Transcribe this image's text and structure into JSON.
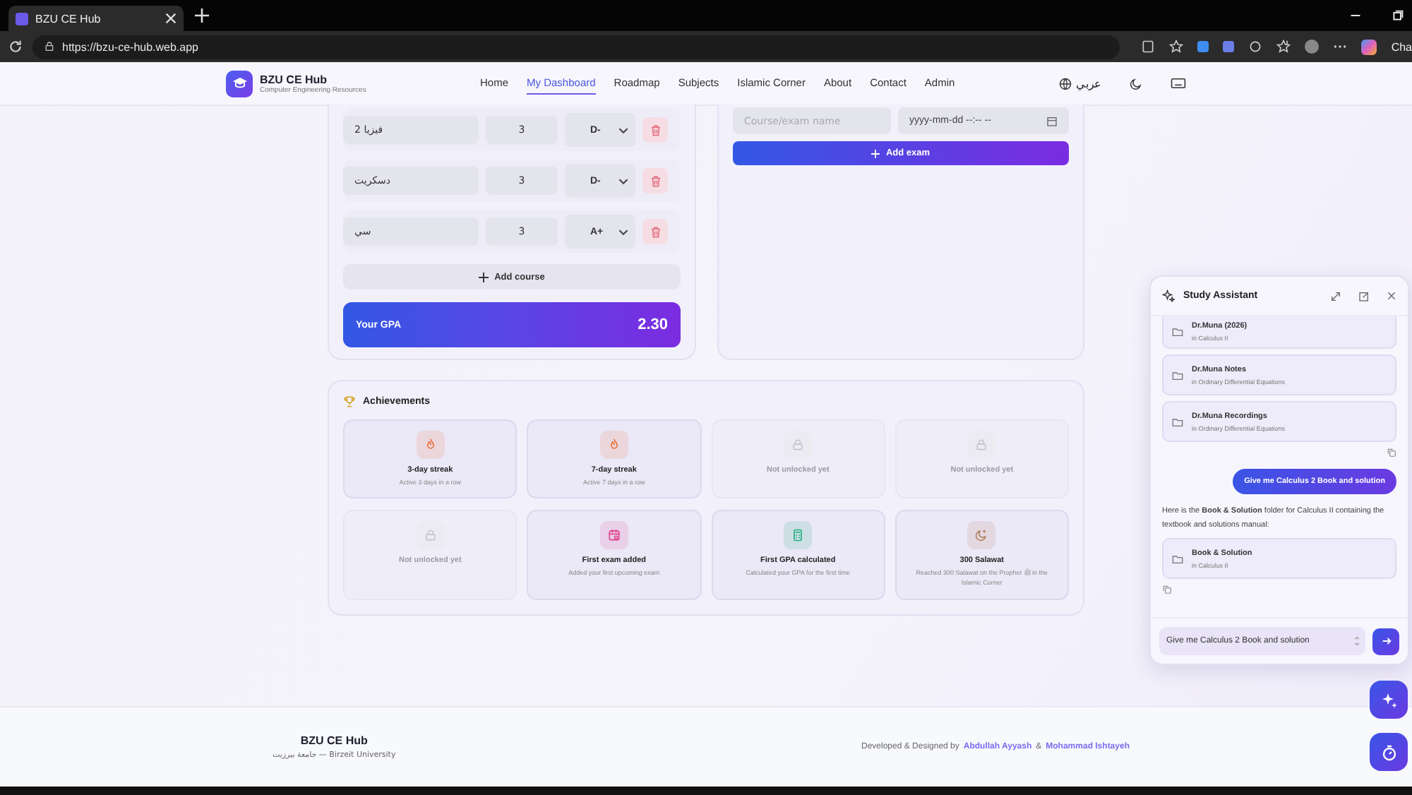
{
  "browser": {
    "tab_title": "BZU CE Hub",
    "url": "https://bzu-ce-hub.web.app",
    "profile_label": "Cha"
  },
  "nav": {
    "brand": "BZU CE Hub",
    "tagline": "Computer Engineering Resources",
    "language": "عربي",
    "links": [
      {
        "label": "Home",
        "selected": false
      },
      {
        "label": "My Dashboard",
        "selected": true
      },
      {
        "label": "Roadmap",
        "selected": false
      },
      {
        "label": "Subjects",
        "selected": false
      },
      {
        "label": "Islamic Corner",
        "selected": false
      },
      {
        "label": "About",
        "selected": false
      },
      {
        "label": "Contact",
        "selected": false
      },
      {
        "label": "Admin",
        "selected": false
      }
    ]
  },
  "gpa_calculator": {
    "courses": [
      {
        "name": "فيزيا 2",
        "credits": "3",
        "grade": "D-"
      },
      {
        "name": "دسكريت",
        "credits": "3",
        "grade": "D-"
      },
      {
        "name": "سي",
        "credits": "3",
        "grade": "A+"
      }
    ],
    "add_label": "Add course",
    "gpa_label": "Your GPA",
    "gpa_value": "2.30"
  },
  "exams": {
    "name_placeholder": "Course/exam name",
    "date_placeholder": "yyyy-mm-dd --:-- --",
    "add_label": "Add exam"
  },
  "achievements": {
    "title": "Achievements",
    "items": [
      {
        "unlocked": true,
        "kind": "streak",
        "color": "#e8703a",
        "title": "3-day streak",
        "description": "Active 3 days in a row"
      },
      {
        "unlocked": true,
        "kind": "streak",
        "color": "#e8703a",
        "title": "7-day streak",
        "description": "Active 7 days in a row"
      },
      {
        "unlocked": false,
        "kind": "locked",
        "title": "Not unlocked yet"
      },
      {
        "unlocked": false,
        "kind": "locked",
        "title": "Not unlocked yet"
      },
      {
        "unlocked": false,
        "kind": "locked",
        "title": "Not unlocked yet"
      },
      {
        "unlocked": true,
        "kind": "exam",
        "color": "#e0458a",
        "title": "First exam added",
        "description": "Added your first upcoming exam"
      },
      {
        "unlocked": true,
        "kind": "gpa",
        "color": "#22b07f",
        "title": "First GPA calculated",
        "description": "Calculated your GPA for the first time"
      },
      {
        "unlocked": true,
        "kind": "salawat",
        "color": "#b2805e",
        "title": "300 Salawat",
        "description": "Reached 300 Salawat on the Prophet ﷺ in the Islamic Corner"
      }
    ]
  },
  "assistant": {
    "title": "Study Assistant",
    "messages": [
      {
        "kind": "folder",
        "title": "Dr.Muna (2026)",
        "path": "in Calculus II"
      },
      {
        "kind": "folder",
        "title": "Dr.Muna Notes",
        "path": "in Ordinary Differential Equations"
      },
      {
        "kind": "folder",
        "title": "Dr.Muna Recordings",
        "path": "in Ordinary Differential Equations"
      },
      {
        "kind": "copy"
      },
      {
        "kind": "user",
        "text": "Give me Calculus 2 Book and solution"
      },
      {
        "kind": "text",
        "text": "Here is the **Book & Solution** folder for Calculus II containing the textbook and solutions manual:"
      },
      {
        "kind": "folder",
        "title": "Book & Solution",
        "path": "in Calculus II"
      },
      {
        "kind": "copy"
      }
    ],
    "input_value": "Give me Calculus 2 Book and solution"
  },
  "footer": {
    "brand": "BZU CE Hub",
    "university": "جامعة بيرزيت — Birzeit University",
    "credit_prefix": "Developed & Designed by",
    "authors": [
      "Abdullah Ayyash",
      "Mohammad Ishtayeh"
    ],
    "joiner": "&"
  }
}
